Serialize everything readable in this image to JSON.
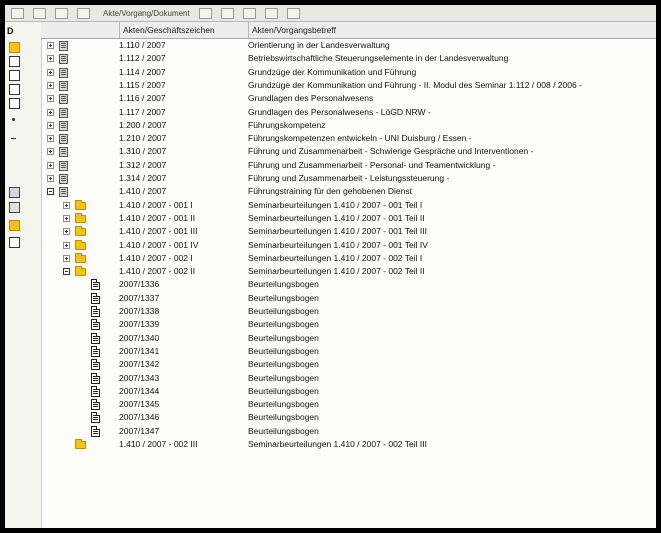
{
  "toolbar": {
    "path_text": "Akte/Vorgang/Dokument"
  },
  "sidebar": {
    "tab_label": "D",
    "icons": [
      "folder-icon",
      "document-icon",
      "document-icon",
      "document-icon",
      "document-icon",
      "pin-icon",
      "dash-icon",
      "person-icon",
      "tree-icon",
      "yellow-folder-icon",
      "document-icon"
    ]
  },
  "header": {
    "col_az": "Akten/Geschäftszeichen",
    "col_betreff": "Akten/Vorgangsbetreff"
  },
  "rows": [
    {
      "type": "akte",
      "az": "1.110 / 2007",
      "betreff": "Orientierung in der Landesverwaltung"
    },
    {
      "type": "akte",
      "az": "1.112 / 2007",
      "betreff": "Betriebswirtschaftliche Steuerungselemente in der Landesverwaltung"
    },
    {
      "type": "akte",
      "az": "1.114 / 2007",
      "betreff": "Grundzüge der Kommunikation und Führung"
    },
    {
      "type": "akte",
      "az": "1.115 / 2007",
      "betreff": "Grundzüge der Kommunikation und Führung - II. Modul des Seminar 1.112 / 008 / 2006 -"
    },
    {
      "type": "akte",
      "az": "1.116 / 2007",
      "betreff": "Grundlagen des Personalwesens"
    },
    {
      "type": "akte",
      "az": "1.117 / 2007",
      "betreff": "Grundlagen des Personalwesens - LöGD NRW -"
    },
    {
      "type": "akte",
      "az": "1.200 / 2007",
      "betreff": "Führungskompetenz"
    },
    {
      "type": "akte",
      "az": "1.210 / 2007",
      "betreff": "Führungskompetenzen entwickeln - UNI Duisburg / Essen -"
    },
    {
      "type": "akte",
      "az": "1.310 / 2007",
      "betreff": "Führung und Zusammenarbeit - Schwierige Gespräche und Interventionen -"
    },
    {
      "type": "akte",
      "az": "1.312 / 2007",
      "betreff": "Führung und Zusammenarbeit - Personal- und Teamentwicklung -"
    },
    {
      "type": "akte",
      "az": "1.314 / 2007",
      "betreff": "Führung und Zusammenarbeit - Leistungssteuerung -"
    },
    {
      "type": "akte-open",
      "az": "1.410 / 2007",
      "betreff": "Führungstraining für den gehobenen Dienst"
    },
    {
      "type": "vorgang",
      "az": "1.410 / 2007 - 001 I",
      "betreff": "Seminarbeurteilungen 1.410 / 2007 - 001 Teil I"
    },
    {
      "type": "vorgang",
      "az": "1.410 / 2007 - 001 II",
      "betreff": "Seminarbeurteilungen 1.410 / 2007 - 001 Teil II"
    },
    {
      "type": "vorgang",
      "az": "1.410 / 2007 - 001 III",
      "betreff": "Seminarbeurteilungen 1.410 / 2007 - 001 Teil III"
    },
    {
      "type": "vorgang",
      "az": "1.410 / 2007 - 001 IV",
      "betreff": "Seminarbeurteilungen 1.410 / 2007 - 001 Teil IV"
    },
    {
      "type": "vorgang",
      "az": "1.410 / 2007 - 002 I",
      "betreff": "Seminarbeurteilungen 1.410 / 2007 - 002 Teil I"
    },
    {
      "type": "vorgang-open",
      "az": "1.410 / 2007 - 002 II",
      "betreff": "Seminarbeurteilungen 1.410 / 2007 - 002 Teil II"
    },
    {
      "type": "doc",
      "az": "2007/1336",
      "betreff": "Beurteilungsbogen"
    },
    {
      "type": "doc",
      "az": "2007/1337",
      "betreff": "Beurteilungsbogen"
    },
    {
      "type": "doc",
      "az": "2007/1338",
      "betreff": "Beurteilungsbogen"
    },
    {
      "type": "doc",
      "az": "2007/1339",
      "betreff": "Beurteilungsbogen"
    },
    {
      "type": "doc",
      "az": "2007/1340",
      "betreff": "Beurteilungsbogen"
    },
    {
      "type": "doc",
      "az": "2007/1341",
      "betreff": "Beurteilungsbogen"
    },
    {
      "type": "doc",
      "az": "2007/1342",
      "betreff": "Beurteilungsbogen"
    },
    {
      "type": "doc",
      "az": "2007/1343",
      "betreff": "Beurteilungsbogen"
    },
    {
      "type": "doc",
      "az": "2007/1344",
      "betreff": "Beurteilungsbogen"
    },
    {
      "type": "doc",
      "az": "2007/1345",
      "betreff": "Beurteilungsbogen"
    },
    {
      "type": "doc",
      "az": "2007/1346",
      "betreff": "Beurteilungsbogen"
    },
    {
      "type": "doc",
      "az": "2007/1347",
      "betreff": "Beurteilungsbogen"
    },
    {
      "type": "vorgang-nox",
      "az": "1.410 / 2007 - 002 III",
      "betreff": "Seminarbeurteilungen 1.410 / 2007 - 002 Teil III"
    }
  ],
  "colors": {
    "folder": "#f3c21b",
    "selection": "#e8eef6"
  }
}
